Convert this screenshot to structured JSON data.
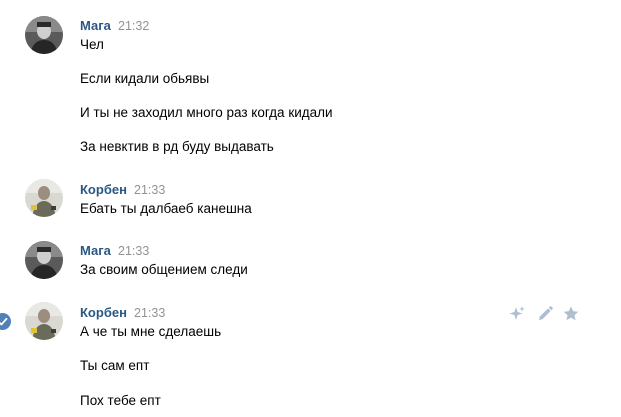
{
  "messages": [
    {
      "author": "Мага",
      "time": "21:32",
      "lines": [
        "Чел",
        "Если кидали обьявы",
        "И ты не заходил много раз когда кидали",
        "За невктив в рд буду выдавать"
      ]
    },
    {
      "author": "Корбен",
      "time": "21:33",
      "lines": [
        "Ебать ты далбаеб канешна"
      ]
    },
    {
      "author": "Мага",
      "time": "21:33",
      "lines": [
        "За своим общением следи"
      ]
    },
    {
      "author": "Корбен",
      "time": "21:33",
      "lines": [
        "А че ты мне сделаешь",
        "Ты сам епт",
        "Пох тебе епт"
      ]
    }
  ],
  "icons": {
    "selected_check": "check-icon",
    "sparkle": "sparkle-icon",
    "edit": "pencil-icon",
    "favorite": "star-icon"
  },
  "colors": {
    "author": "#2a5885",
    "time": "#939393",
    "text": "#000000",
    "check": "#5181b8",
    "action_icons": "#aebed0"
  }
}
